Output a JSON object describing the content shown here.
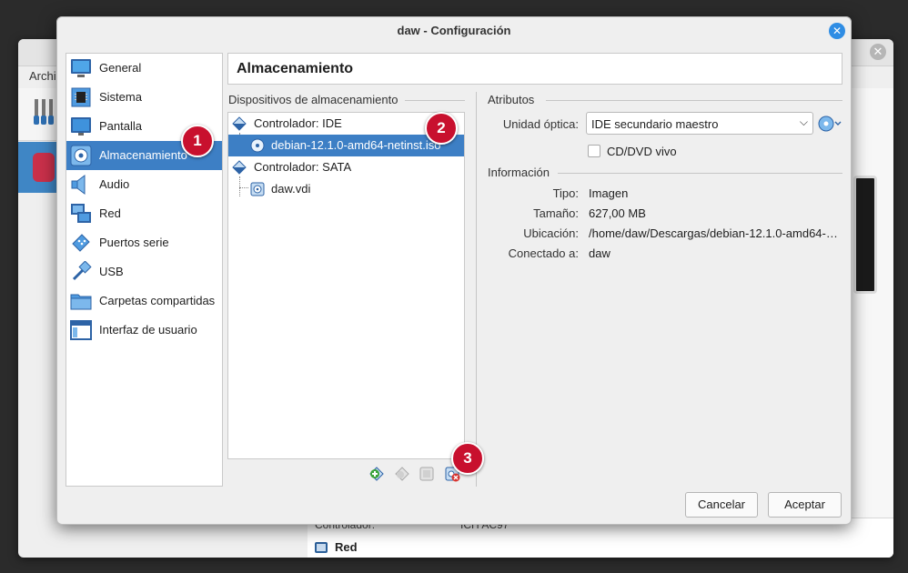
{
  "background_window": {
    "menu_partial": "Archi",
    "controller_label": "Controlador:",
    "controller_value": "ICH AC97",
    "section_red": "Red"
  },
  "dialog": {
    "title": "daw - Configuración",
    "header": "Almacenamiento"
  },
  "categories": [
    {
      "label": "General",
      "icon": "monitor-icon"
    },
    {
      "label": "Sistema",
      "icon": "chip-icon"
    },
    {
      "label": "Pantalla",
      "icon": "display-icon"
    },
    {
      "label": "Almacenamiento",
      "icon": "disk-icon",
      "selected": true
    },
    {
      "label": "Audio",
      "icon": "speaker-icon"
    },
    {
      "label": "Red",
      "icon": "network-icon"
    },
    {
      "label": "Puertos serie",
      "icon": "serial-port-icon"
    },
    {
      "label": "USB",
      "icon": "usb-icon"
    },
    {
      "label": "Carpetas compartidas",
      "icon": "folder-icon"
    },
    {
      "label": "Interfaz de usuario",
      "icon": "window-icon"
    }
  ],
  "storage": {
    "group_label": "Dispositivos de almacenamiento",
    "tree": [
      {
        "label": "Controlador: IDE",
        "icon": "ide-controller-icon",
        "level": 0
      },
      {
        "label": "debian-12.1.0-amd64-netinst.iso",
        "icon": "optical-disc-icon",
        "level": 1,
        "selected": true
      },
      {
        "label": "Controlador: SATA",
        "icon": "sata-controller-icon",
        "level": 0
      },
      {
        "label": "daw.vdi",
        "icon": "hard-disk-icon",
        "level": 1
      }
    ],
    "toolbar": [
      "add-attachment-icon",
      "remove-attachment-icon",
      "add-controller-icon",
      "remove-controller-icon"
    ]
  },
  "attributes": {
    "group_label": "Atributos",
    "optical_drive_label": "Unidad óptica:",
    "optical_drive_value": "IDE secundario maestro",
    "live_cd_label": "CD/DVD vivo",
    "live_cd_checked": false
  },
  "information": {
    "group_label": "Información",
    "rows": [
      {
        "label": "Tipo:",
        "value": "Imagen"
      },
      {
        "label": "Tamaño:",
        "value": "627,00 MB"
      },
      {
        "label": "Ubicación:",
        "value": "/home/daw/Descargas/debian-12.1.0-amd64-…"
      },
      {
        "label": "Conectado a:",
        "value": "daw"
      }
    ]
  },
  "buttons": {
    "cancel": "Cancelar",
    "accept": "Aceptar"
  },
  "badges": [
    "1",
    "2",
    "3"
  ],
  "colors": {
    "selection": "#3d7fc5",
    "badge": "#c8102e",
    "close_button": "#2f8de4"
  }
}
